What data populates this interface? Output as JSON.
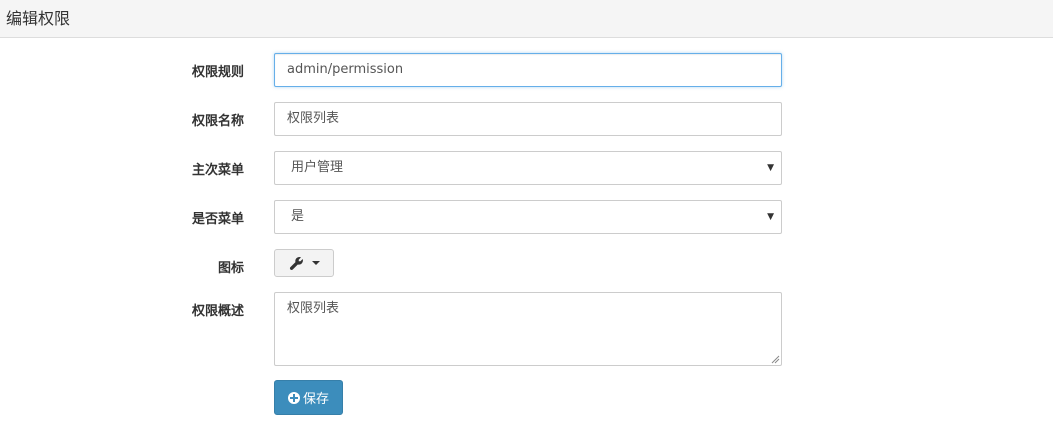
{
  "header": {
    "title": "编辑权限"
  },
  "form": {
    "rule": {
      "label": "权限规则",
      "value": "admin/permission"
    },
    "name": {
      "label": "权限名称",
      "value": "权限列表"
    },
    "parent_menu": {
      "label": "主次菜单",
      "value": "用户管理"
    },
    "is_menu": {
      "label": "是否菜单",
      "value": "是"
    },
    "icon": {
      "label": "图标",
      "icon_name": "wrench-icon"
    },
    "description": {
      "label": "权限概述",
      "value": "权限列表"
    },
    "save_label": "保存"
  },
  "colors": {
    "primary": "#3c8dbc",
    "focus_border": "#66afe9",
    "header_bg": "#f5f5f5"
  }
}
